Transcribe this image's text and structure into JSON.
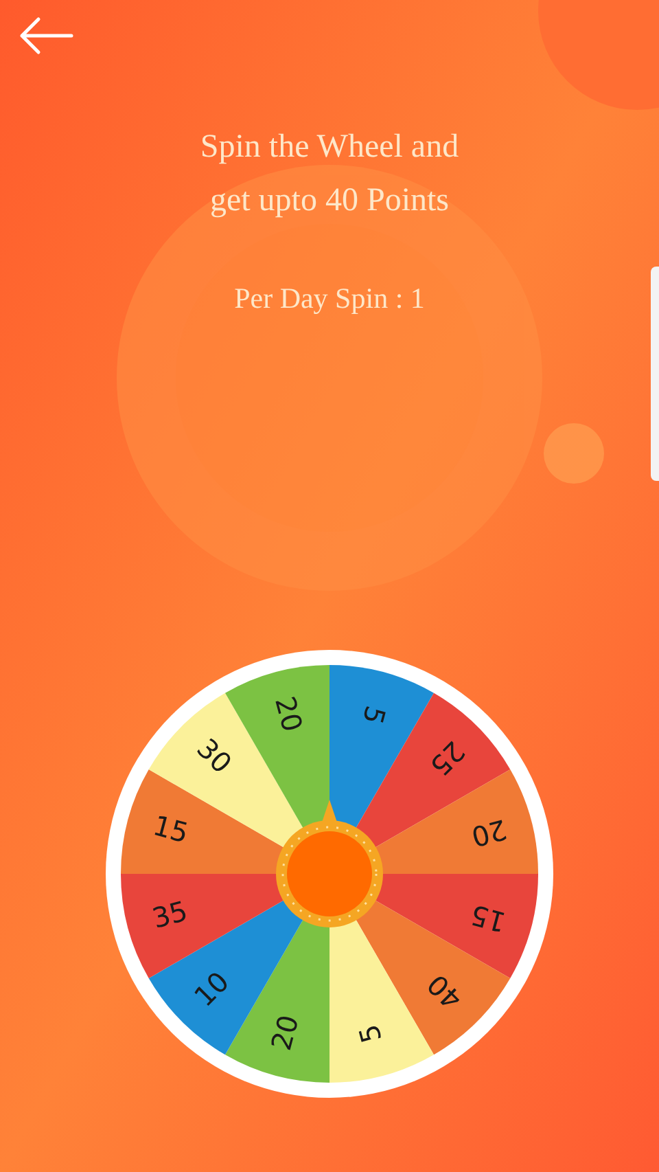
{
  "title_lines": [
    "Spin the Wheel and",
    "get upto 40 Points"
  ],
  "spin_info": "Per Day Spin : 1",
  "segments": [
    {
      "value": "5",
      "color": "#1e8fd5"
    },
    {
      "value": "25",
      "color": "#e8453c"
    },
    {
      "value": "20",
      "color": "#f07a35"
    },
    {
      "value": "15",
      "color": "#e8453c"
    },
    {
      "value": "40",
      "color": "#f07a35"
    },
    {
      "value": "5",
      "color": "#fbf19a"
    },
    {
      "value": "20",
      "color": "#7cc243"
    },
    {
      "value": "10",
      "color": "#1e8fd5"
    },
    {
      "value": "35",
      "color": "#e8453c"
    },
    {
      "value": "15",
      "color": "#f07a35"
    },
    {
      "value": "30",
      "color": "#fbf19a"
    },
    {
      "value": "20",
      "color": "#7cc243"
    }
  ]
}
